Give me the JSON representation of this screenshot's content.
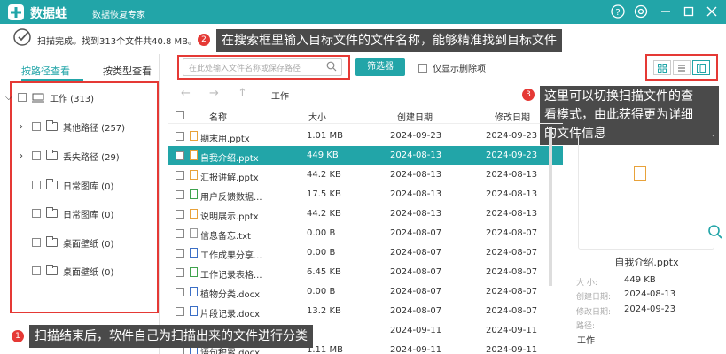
{
  "titlebar": {
    "brand": "数据蛙",
    "subtitle": "数据恢复专家",
    "icons": [
      "help-icon",
      "settings-icon",
      "minimize-icon",
      "close-icon"
    ]
  },
  "scan": {
    "status": "扫描完成。找到313个文件共40.8 MB。"
  },
  "annotations": {
    "a1": {
      "num": "1",
      "text": "扫描结束后，软件自己为扫描出来的文件进行分类"
    },
    "a2": {
      "num": "2",
      "text": "在搜索框里输入目标文件的文件名称，能够精准找到目标文件"
    },
    "a3": {
      "num": "3",
      "line1": "这里可以切换扫描文件的查",
      "line2": "看模式，由此获得更为详细",
      "line3": "的文件信息"
    }
  },
  "left": {
    "tabs": [
      "按路径查看",
      "按类型查看"
    ],
    "root": "工作 (313)",
    "items": [
      {
        "label": "其他路径 (257)",
        "expand": true
      },
      {
        "label": "丢失路径 (29)",
        "expand": true
      },
      {
        "label": "日常图库 (0)",
        "expand": false
      },
      {
        "label": "日常图库 (0)",
        "expand": false
      },
      {
        "label": "桌面壁纸 (0)",
        "expand": false
      },
      {
        "label": "桌面壁纸 (0)",
        "expand": false
      }
    ]
  },
  "toolbar": {
    "search_placeholder": "在此处输入文件名称或保存路径",
    "filter_label": "筛选器",
    "deleted_only": "仅显示删除项"
  },
  "path": {
    "current": "工作"
  },
  "table": {
    "headers": [
      "名称",
      "大小",
      "创建日期",
      "修改日期"
    ],
    "rows": [
      {
        "name": "期末用.pptx",
        "size": "1.01 MB",
        "created": "2024-09-23",
        "modified": "2024-09-23",
        "color": "#e8a23a"
      },
      {
        "name": "自我介绍.pptx",
        "size": "449 KB",
        "created": "2024-08-13",
        "modified": "2024-09-23",
        "color": "#e8a23a",
        "selected": true
      },
      {
        "name": "汇报讲解.pptx",
        "size": "44.2 KB",
        "created": "2024-08-13",
        "modified": "2024-08-13",
        "color": "#e8a23a"
      },
      {
        "name": "用户反馈数据...",
        "size": "17.5 KB",
        "created": "2024-08-13",
        "modified": "2024-08-13",
        "color": "#3fa34d"
      },
      {
        "name": "说明展示.pptx",
        "size": "44.2 KB",
        "created": "2024-08-13",
        "modified": "2024-08-13",
        "color": "#e8a23a"
      },
      {
        "name": "信息备忘.txt",
        "size": "0.00  B",
        "created": "2024-08-07",
        "modified": "2024-08-07",
        "color": "#999999"
      },
      {
        "name": "工作成果分享...",
        "size": "0.00  B",
        "created": "2024-08-07",
        "modified": "2024-08-07",
        "color": "#3b6fc6"
      },
      {
        "name": "工作记录表格...",
        "size": "6.45 KB",
        "created": "2024-08-07",
        "modified": "2024-08-07",
        "color": "#3fa34d"
      },
      {
        "name": "植物分类.docx",
        "size": "0.00  B",
        "created": "2024-08-07",
        "modified": "2024-08-07",
        "color": "#3b6fc6"
      },
      {
        "name": "片段记录.docx",
        "size": "13.2 KB",
        "created": "2024-08-07",
        "modified": "2024-08-07",
        "color": "#3b6fc6"
      },
      {
        "name": "",
        "size": "",
        "created": "2024-09-11",
        "modified": "2024-09-11",
        "color": "#3b6fc6"
      },
      {
        "name": "语句积累.docx",
        "size": "1.11 MB",
        "created": "2024-09-11",
        "modified": "2024-09-11",
        "color": "#3b6fc6"
      }
    ]
  },
  "preview": {
    "name": "自我介绍.pptx",
    "fields": [
      {
        "k": "大 小:",
        "v": "449 KB"
      },
      {
        "k": "创建日期:",
        "v": "2024-08-13"
      },
      {
        "k": "修改日期:",
        "v": "2024-09-23"
      },
      {
        "k": "路径:",
        "v": ""
      }
    ],
    "path_value": "工作"
  },
  "colors": {
    "accent": "#22a5a8",
    "annotation": "#e53935"
  }
}
